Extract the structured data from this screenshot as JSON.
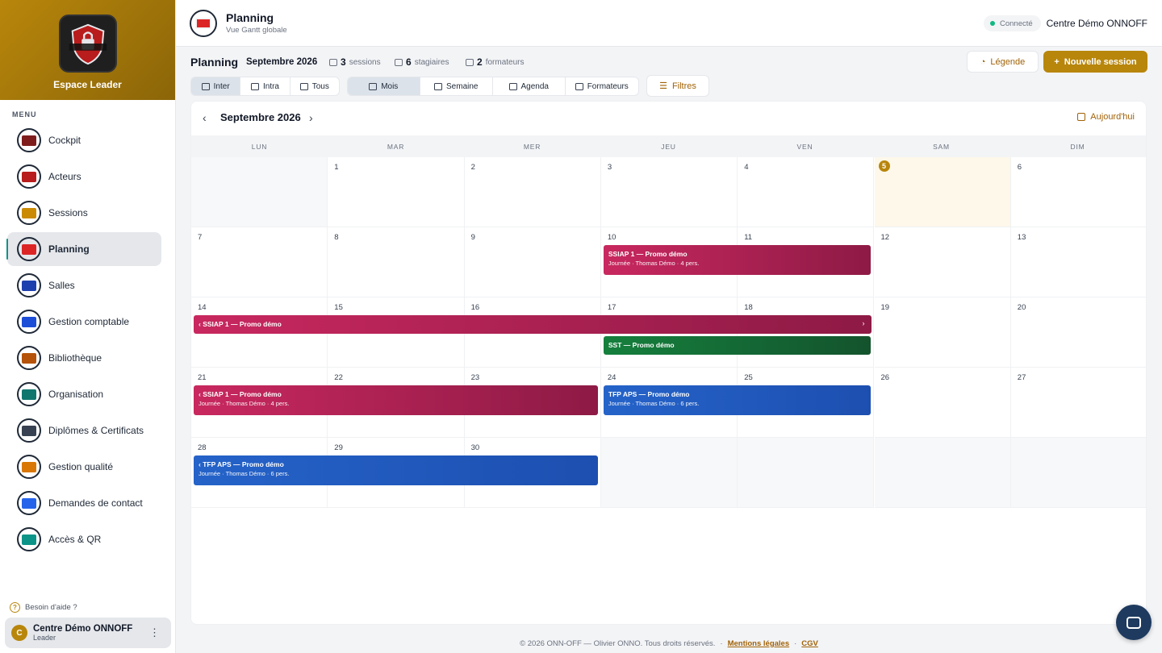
{
  "sidebar": {
    "brand_title": "Espace Leader",
    "menu_label": "MENU",
    "items": [
      {
        "label": "Cockpit",
        "icon": "cockpit-icon",
        "color": "#7f1d1d"
      },
      {
        "label": "Acteurs",
        "icon": "actors-icon",
        "color": "#b91c1c"
      },
      {
        "label": "Sessions",
        "icon": "sessions-icon",
        "color": "#ca8a04"
      },
      {
        "label": "Planning",
        "icon": "planning-icon",
        "color": "#dc2626",
        "active": true
      },
      {
        "label": "Salles",
        "icon": "rooms-icon",
        "color": "#1e40af"
      },
      {
        "label": "Gestion comptable",
        "icon": "accounting-icon",
        "color": "#1d4ed8"
      },
      {
        "label": "Bibliothèque",
        "icon": "library-icon",
        "color": "#b45309"
      },
      {
        "label": "Organisation",
        "icon": "organisation-icon",
        "color": "#0f766e"
      },
      {
        "label": "Diplômes & Certificats",
        "icon": "diploma-icon",
        "color": "#374151"
      },
      {
        "label": "Gestion qualité",
        "icon": "quality-icon",
        "color": "#d97706"
      },
      {
        "label": "Demandes de contact",
        "icon": "contact-icon",
        "color": "#2563eb"
      },
      {
        "label": "Accès & QR",
        "icon": "qr-icon",
        "color": "#0d9488"
      }
    ],
    "help": "Besoin d'aide ?",
    "user": {
      "initial": "C",
      "name": "Centre Démo ONNOFF",
      "role": "Leader"
    }
  },
  "header": {
    "title": "Planning",
    "subtitle": "Vue Gantt globale",
    "status": "Connecté",
    "center_name": "Centre Démo ONNOFF"
  },
  "toolbar": {
    "title": "Planning",
    "month": "Septembre 2026",
    "stats": [
      {
        "value": "3",
        "label": "sessions"
      },
      {
        "value": "6",
        "label": "stagiaires"
      },
      {
        "value": "2",
        "label": "formateurs"
      }
    ],
    "legend_label": "Légende",
    "new_session_label": "Nouvelle session",
    "scope_tabs": [
      "Inter",
      "Intra",
      "Tous"
    ],
    "scope_selected": "Inter",
    "view_tabs": [
      "Mois",
      "Semaine",
      "Agenda",
      "Formateurs"
    ],
    "view_selected": "Mois",
    "filter_label": "Filtres"
  },
  "calendar": {
    "title": "Septembre 2026",
    "today_label": "Aujourd'hui",
    "weekdays": [
      "LUN",
      "MAR",
      "MER",
      "JEU",
      "VEN",
      "SAM",
      "DIM"
    ],
    "today": "5",
    "weeks": [
      [
        "",
        "1",
        "2",
        "3",
        "4",
        "5",
        "6"
      ],
      [
        "7",
        "8",
        "9",
        "10",
        "11",
        "12",
        "13"
      ],
      [
        "14",
        "15",
        "16",
        "17",
        "18",
        "19",
        "20"
      ],
      [
        "21",
        "22",
        "23",
        "24",
        "25",
        "26",
        "27"
      ],
      [
        "28",
        "29",
        "30",
        "",
        "",
        "",
        ""
      ]
    ],
    "events": [
      {
        "title": "SSIAP 1 — Promo démo",
        "meta": "Journée  ·  Thomas Démo  ·  4 pers.",
        "color": "red"
      },
      {
        "title": "‹ SSIAP 1 — Promo démo",
        "meta": "",
        "color": "red",
        "continues": "›"
      },
      {
        "title": "SST — Promo démo",
        "meta": "",
        "color": "green"
      },
      {
        "title": "‹ SSIAP 1 — Promo démo",
        "meta": "Journée  ·  Thomas Démo  ·  4 pers.",
        "color": "red"
      },
      {
        "title": "TFP APS — Promo démo",
        "meta": "Journée  ·  Thomas Démo  ·  6 pers.",
        "color": "blue"
      },
      {
        "title": "‹ TFP APS — Promo démo",
        "meta": "Journée  ·  Thomas Démo  ·  6 pers.",
        "color": "blue"
      }
    ]
  },
  "footer": {
    "copyright": "© 2026 ONN-OFF — Olivier ONNO. Tous droits réservés.",
    "sep1": "·",
    "legal": "Mentions légales",
    "sep2": "·",
    "cgv": "CGV"
  }
}
